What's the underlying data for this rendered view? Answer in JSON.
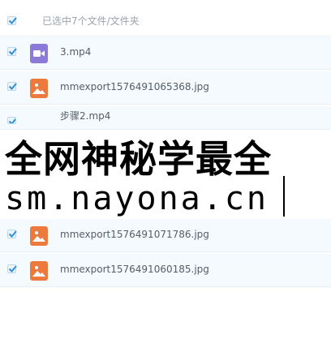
{
  "header": {
    "selection_text": "已选中7个文件/文件夹"
  },
  "files": [
    {
      "name": "3.mp4",
      "icon": "video-icon",
      "color": "#8b7ad8"
    },
    {
      "name": "mmexport1576491065368.jpg",
      "icon": "image-icon",
      "color": "#ec7a3c"
    },
    {
      "name": "步骤2.mp4",
      "icon": "video-icon",
      "color": "#8b7ad8"
    },
    {
      "name": "mmexport1576491071786.jpg",
      "icon": "image-icon",
      "color": "#ec7a3c"
    },
    {
      "name": "mmexport1576491060185.jpg",
      "icon": "image-icon",
      "color": "#ec7a3c"
    }
  ],
  "overlay": {
    "line1": "全网神秘学最全",
    "line2": "sm.nayona.cn"
  },
  "colors": {
    "checkbox_check": "#2f8fd8",
    "row_bg": "#f4fafe"
  }
}
